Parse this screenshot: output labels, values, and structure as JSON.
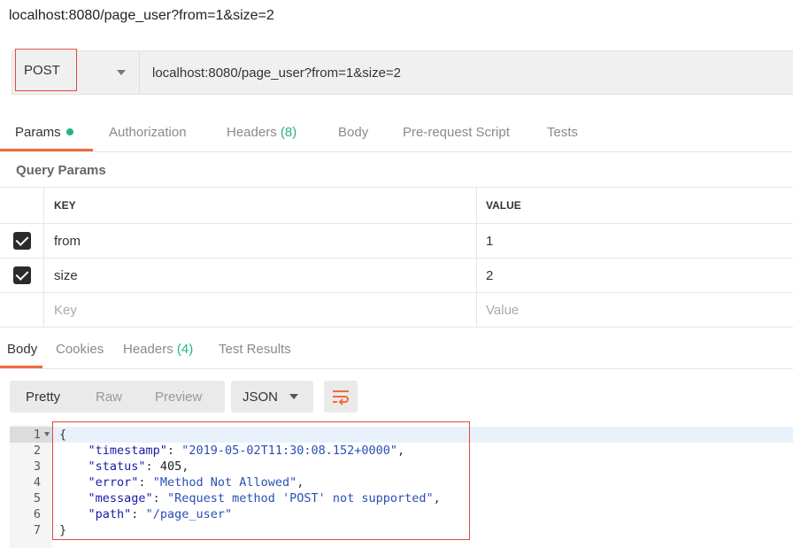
{
  "window": {
    "title": "localhost:8080/page_user?from=1&size=2"
  },
  "request": {
    "method": "POST",
    "url": "localhost:8080/page_user?from=1&size=2"
  },
  "request_tabs": {
    "params": "Params",
    "authorization": "Authorization",
    "headers": "Headers",
    "headers_count": "(8)",
    "body": "Body",
    "prerequest": "Pre-request Script",
    "tests": "Tests"
  },
  "query_params": {
    "title": "Query Params",
    "col_key": "KEY",
    "col_value": "VALUE",
    "rows": [
      {
        "key": "from",
        "value": "1"
      },
      {
        "key": "size",
        "value": "2"
      }
    ],
    "key_placeholder": "Key",
    "value_placeholder": "Value"
  },
  "response_tabs": {
    "body": "Body",
    "cookies": "Cookies",
    "headers": "Headers",
    "headers_count": "(4)",
    "test_results": "Test Results"
  },
  "toolbar": {
    "pretty": "Pretty",
    "raw": "Raw",
    "preview": "Preview",
    "format": "JSON",
    "wrap_icon": "wrap-lines-icon"
  },
  "code": {
    "line_numbers": [
      "1",
      "2",
      "3",
      "4",
      "5",
      "6",
      "7"
    ],
    "open_brace": "{",
    "close_brace": "}",
    "fields": [
      {
        "key": "\"timestamp\"",
        "value": "\"2019-05-02T11:30:08.152+0000\"",
        "trail": ","
      },
      {
        "key": "\"status\"",
        "value": "405",
        "trail": ","
      },
      {
        "key": "\"error\"",
        "value": "\"Method Not Allowed\"",
        "trail": ","
      },
      {
        "key": "\"message\"",
        "value": "\"Request method 'POST' not supported\"",
        "trail": ","
      },
      {
        "key": "\"path\"",
        "value": "\"/page_user\"",
        "trail": ""
      }
    ]
  },
  "colors": {
    "accent": "#f26b3a",
    "green": "#26b47f",
    "highlight": "#e04a3f"
  }
}
